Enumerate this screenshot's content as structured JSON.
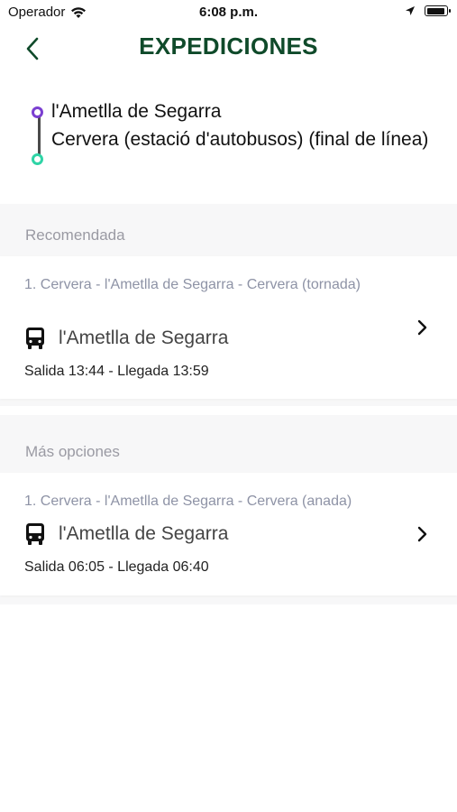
{
  "status_bar": {
    "carrier": "Operador",
    "time": "6:08 p.m."
  },
  "header": {
    "title": "EXPEDICIONES"
  },
  "route": {
    "origin": "l'Ametlla de Segarra",
    "destination": "Cervera (estació d'autobusos) (final de línea)",
    "origin_color": "#7b3fd1",
    "destination_color": "#2fd4a6"
  },
  "recommended": {
    "label": "Recomendada",
    "card": {
      "route": "1. Cervera - l'Ametlla de Segarra - Cervera (tornada)",
      "stop": "l'Ametlla de Segarra",
      "times": "Salida 13:44 - Llegada 13:59",
      "icon": "bus-icon"
    }
  },
  "more_options": {
    "label": "Más opciones",
    "card": {
      "route": "1. Cervera - l'Ametlla de Segarra - Cervera (anada)",
      "stop": "l'Ametlla de Segarra",
      "times": "Salida 06:05 - Llegada 06:40",
      "icon": "bus-icon"
    }
  },
  "colors": {
    "title": "#0f4a2a",
    "section_background": "#f7f7f8",
    "muted_text": "#8e93a6"
  }
}
